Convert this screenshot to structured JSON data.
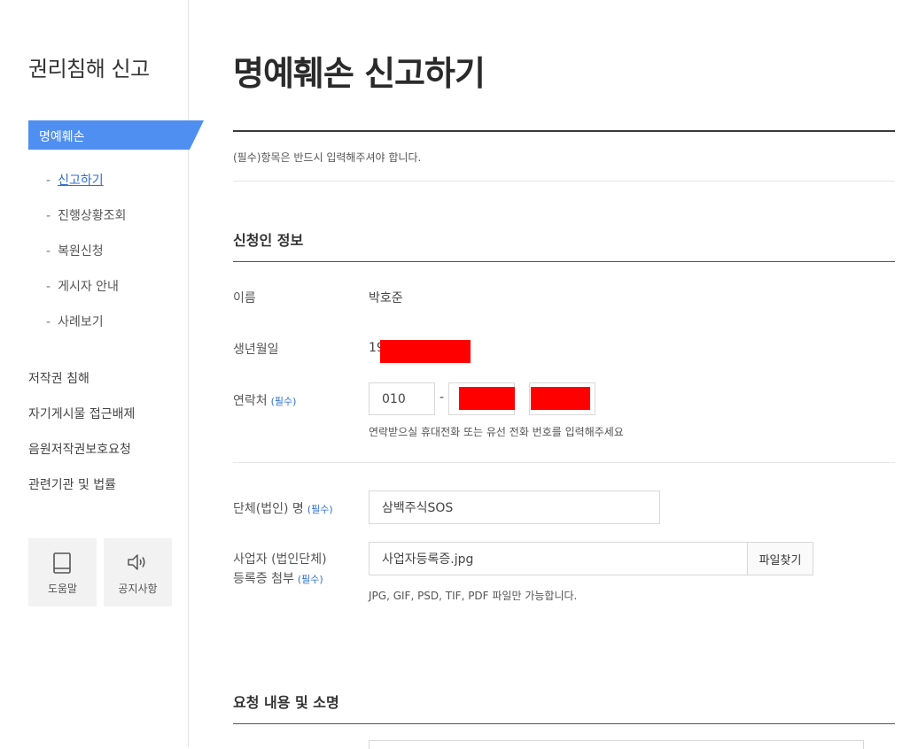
{
  "sidebar": {
    "title": "권리침해 신고",
    "active_section": "명예훼손",
    "sub_items": [
      {
        "label": "신고하기"
      },
      {
        "label": "진행상황조회"
      },
      {
        "label": "복원신청"
      },
      {
        "label": "게시자 안내"
      },
      {
        "label": "사례보기"
      }
    ],
    "main_items": [
      {
        "label": "저작권 침해"
      },
      {
        "label": "자기게시물 접근배제"
      },
      {
        "label": "음원저작권보호요청"
      },
      {
        "label": "관련기관 및 법률"
      }
    ],
    "sub_item_dash": "-",
    "quick_buttons": [
      {
        "label": "도움말",
        "icon": "book-icon"
      },
      {
        "label": "공지사항",
        "icon": "speaker-icon"
      }
    ]
  },
  "main": {
    "page_title": "명예훼손 신고하기",
    "required_note": "(필수)항목은 반드시 입력해주셔야 합니다.",
    "applicant_section_title": "신청인 정보",
    "required_tag": "(필수)",
    "name_label": "이름",
    "name_value": "박호준",
    "birth_label": "생년월일",
    "birth_value_prefix": "19",
    "phone_label": "연락처",
    "phone_first": "010",
    "phone_separator": "-",
    "phone_help": "연락받으실 휴대전화 또는 유선 전화 번호를 입력해주세요",
    "org_label": "단체(법인) 명",
    "org_value": "삼백주식SOS",
    "biz_label_line1": "사업자 (법인단체)",
    "biz_label_line2": "등록증 첨부",
    "biz_file": "사업자등록증.jpg",
    "find_file_button": "파일찾기",
    "file_help": "JPG, GIF, PSD, TIF, PDF 파일만 가능합니다.",
    "request_section_title": "요청 내용 및 소명"
  },
  "colors": {
    "accent": "#4f8ff1",
    "link": "#2e6fd1",
    "redaction": "#ff0000"
  }
}
